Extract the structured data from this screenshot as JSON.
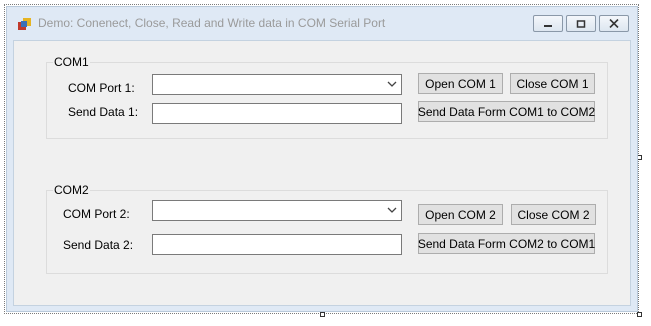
{
  "window": {
    "title": "Demo: Conenect, Close, Read and Write data in COM Serial Port"
  },
  "icons": {
    "app": "app-form-icon",
    "minimize": "minimize-icon",
    "maximize": "maximize-icon",
    "close": "close-icon",
    "dropdown": "chevron-down-icon"
  },
  "com1": {
    "group_title": "COM1",
    "port_label": "COM Port 1:",
    "port_value": "",
    "send_label": "Send Data 1:",
    "send_value": "",
    "open_button": "Open COM 1",
    "close_button": "Close COM 1",
    "send_button": "Send Data Form COM1 to COM2"
  },
  "com2": {
    "group_title": "COM2",
    "port_label": "COM Port 2:",
    "port_value": "",
    "send_label": "Send Data 2:",
    "send_value": "",
    "open_button": "Open COM 2",
    "close_button": "Close COM 2",
    "send_button": "Send Data Form COM2 to COM1"
  },
  "colors": {
    "client_bg": "#f0f0f0",
    "frame": "#dfe9f5",
    "button_bg": "#e1e1e1",
    "title_text": "#9a9a9a"
  }
}
